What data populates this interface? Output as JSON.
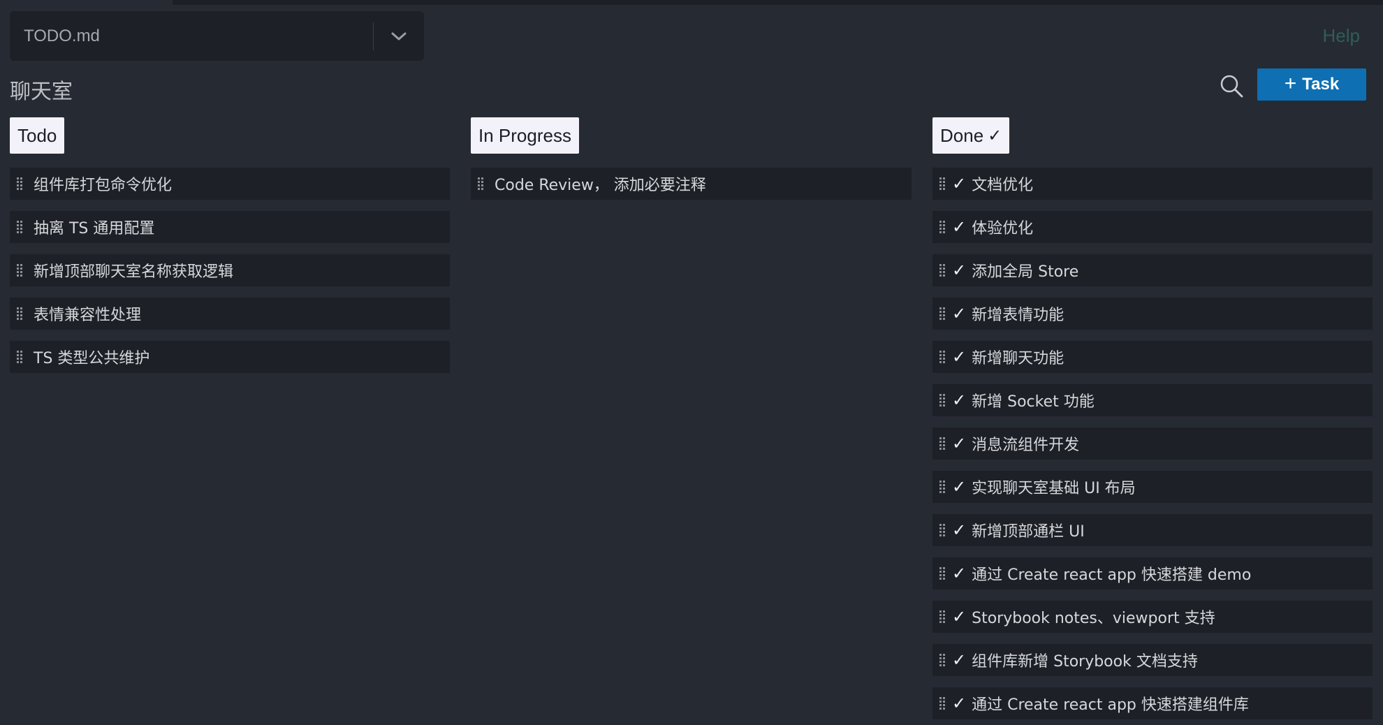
{
  "file_select": {
    "value": "TODO.md",
    "chevron_icon": "chevron-down-icon"
  },
  "help_label": "Help",
  "board_title": "聊天室",
  "search_icon": "search-icon",
  "add_task": {
    "plus": "+",
    "label": "Task"
  },
  "columns": {
    "todo": {
      "title": "Todo",
      "cards": [
        "组件库打包命令优化",
        "抽离 TS 通用配置",
        "新增顶部聊天室名称获取逻辑",
        "表情兼容性处理",
        "TS 类型公共维护"
      ]
    },
    "progress": {
      "title": "In Progress",
      "cards": [
        "Code Review， 添加必要注释"
      ]
    },
    "done": {
      "title": "Done",
      "title_mark": "✓",
      "card_mark": "✓",
      "cards": [
        "文档优化",
        "体验优化",
        "添加全局 Store",
        "新增表情功能",
        "新增聊天功能",
        "新增 Socket 功能",
        "消息流组件开发",
        "实现聊天室基础 UI 布局",
        "新增顶部通栏 UI",
        "通过 Create react app 快速搭建 demo",
        "Storybook notes、viewport 支持",
        "组件库新增 Storybook 文档支持",
        "通过 Create react app 快速搭建组件库"
      ]
    }
  },
  "colors": {
    "background": "#262a33",
    "card": "#1d2026",
    "accent_button": "#0e6fb3",
    "help_link": "#2f5e55",
    "column_header_bg": "#f3f2fa"
  }
}
